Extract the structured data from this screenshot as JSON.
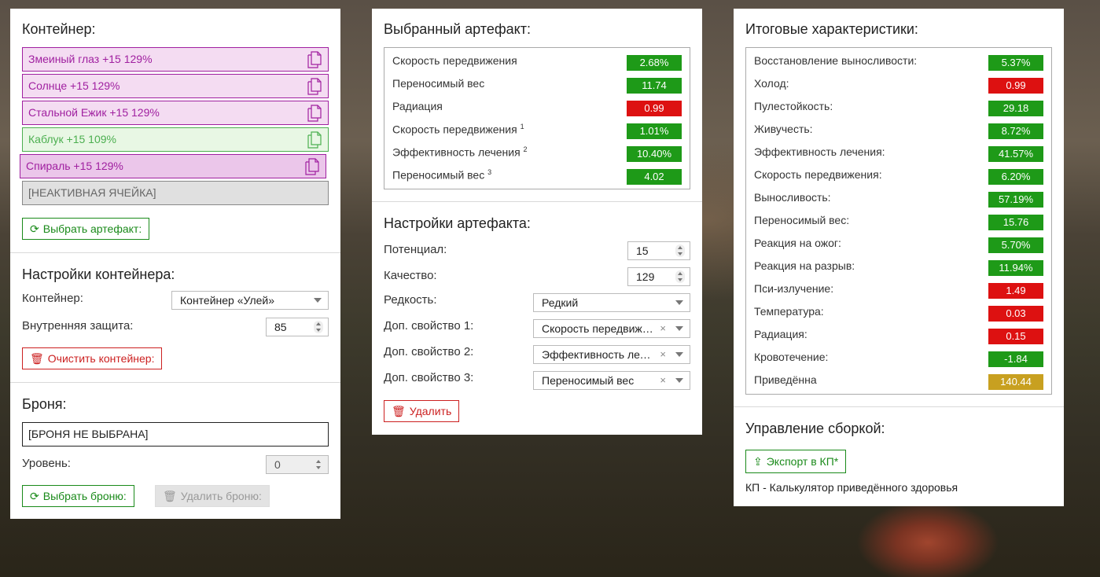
{
  "container": {
    "title": "Контейнер:",
    "slots": [
      {
        "label": "Змеиный глаз +15 129%",
        "style": "purple"
      },
      {
        "label": "Солнце +15 129%",
        "style": "purple"
      },
      {
        "label": "Стальной Ежик +15 129%",
        "style": "purple"
      },
      {
        "label": "Каблук +15 109%",
        "style": "green"
      },
      {
        "label": "Спираль +15 129%",
        "style": "selected"
      },
      {
        "label": "[НЕАКТИВНАЯ ЯЧЕЙКА]",
        "style": "inactive"
      }
    ],
    "select_artifact_label": "Выбрать артефакт:"
  },
  "container_settings": {
    "title": "Настройки контейнера:",
    "container_label": "Контейнер:",
    "container_value": "Контейнер «Улей»",
    "protection_label": "Внутренняя защита:",
    "protection_value": "85",
    "clear_label": "Очистить контейнер:"
  },
  "armor": {
    "title": "Броня:",
    "value": "[БРОНЯ НЕ ВЫБРАНА]",
    "level_label": "Уровень:",
    "level_value": "0",
    "select_label": "Выбрать броню:",
    "delete_label": "Удалить броню:"
  },
  "selected_artifact": {
    "title": "Выбранный артефакт:",
    "stats": [
      {
        "name": "Скорость передвижения",
        "sup": "",
        "value": "2.68%",
        "color": "green"
      },
      {
        "name": "Переносимый вес",
        "sup": "",
        "value": "11.74",
        "color": "green"
      },
      {
        "name": "Радиация",
        "sup": "",
        "value": "0.99",
        "color": "red"
      },
      {
        "name": "Скорость передвижения",
        "sup": "1",
        "value": "1.01%",
        "color": "green"
      },
      {
        "name": "Эффективность лечения",
        "sup": "2",
        "value": "10.40%",
        "color": "green"
      },
      {
        "name": "Переносимый вес",
        "sup": "3",
        "value": "4.02",
        "color": "green"
      }
    ]
  },
  "artifact_settings": {
    "title": "Настройки артефакта:",
    "potential_label": "Потенциал:",
    "potential_value": "15",
    "quality_label": "Качество:",
    "quality_value": "129",
    "rarity_label": "Редкость:",
    "rarity_value": "Редкий",
    "extra1_label": "Доп. свойство 1:",
    "extra1_value": "Скорость передвижения",
    "extra2_label": "Доп. свойство 2:",
    "extra2_value": "Эффективность лечения",
    "extra3_label": "Доп. свойство 3:",
    "extra3_value": "Переносимый вес",
    "delete_label": "Удалить"
  },
  "total": {
    "title": "Итоговые характеристики:",
    "stats": [
      {
        "name": "Восстановление выносливости:",
        "value": "5.37%",
        "color": "green"
      },
      {
        "name": "Холод:",
        "value": "0.99",
        "color": "red"
      },
      {
        "name": "Пулестойкость:",
        "value": "29.18",
        "color": "green"
      },
      {
        "name": "Живучесть:",
        "value": "8.72%",
        "color": "green"
      },
      {
        "name": "Эффективность лечения:",
        "value": "41.57%",
        "color": "green"
      },
      {
        "name": "Скорость передвижения:",
        "value": "6.20%",
        "color": "green"
      },
      {
        "name": "Выносливость:",
        "value": "57.19%",
        "color": "green"
      },
      {
        "name": "Переносимый вес:",
        "value": "15.76",
        "color": "green"
      },
      {
        "name": "Реакция на ожог:",
        "value": "5.70%",
        "color": "green"
      },
      {
        "name": "Реакция на разрыв:",
        "value": "11.94%",
        "color": "green"
      },
      {
        "name": "Пси-излучение:",
        "value": "1.49",
        "color": "red"
      },
      {
        "name": "Температура:",
        "value": "0.03",
        "color": "red"
      },
      {
        "name": "Радиация:",
        "value": "0.15",
        "color": "red"
      },
      {
        "name": "Кровотечение:",
        "value": "-1.84",
        "color": "green"
      },
      {
        "name": "Приведённа",
        "value": "140.44",
        "color": "yellow"
      }
    ]
  },
  "build": {
    "title": "Управление сборкой:",
    "export_label": "Экспорт в КП*",
    "note": "КП - Калькулятор приведённого здоровья"
  },
  "colors": {
    "green": "#1e9a18",
    "red": "#dd1111",
    "yellow": "#c8a020",
    "purple": "#a020a0"
  }
}
